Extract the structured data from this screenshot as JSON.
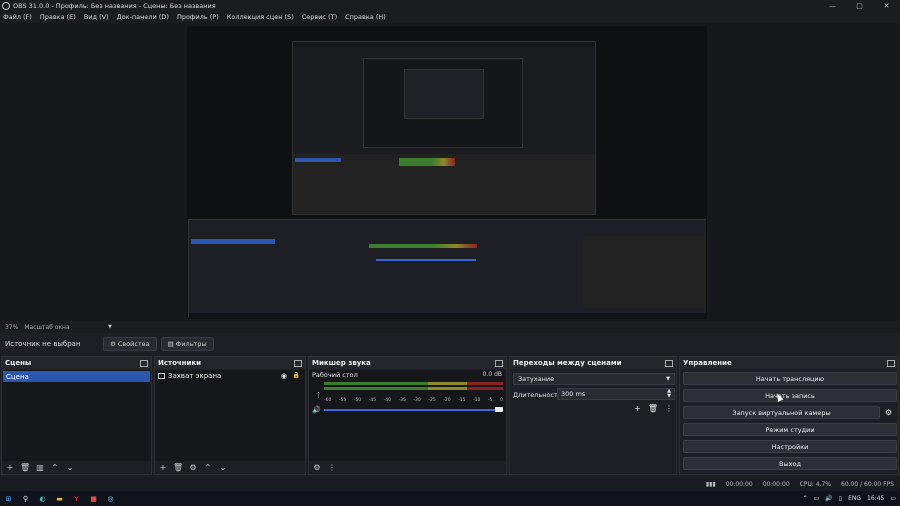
{
  "window": {
    "title": "OBS 31.0.0 - Профиль: Без названия - Сцены: Без названия",
    "minimize": "—",
    "maximize": "▢",
    "close": "✕"
  },
  "menu": [
    "Файл (F)",
    "Правка (E)",
    "Вид (V)",
    "Док-панели (D)",
    "Профиль (P)",
    "Коллекция сцен (S)",
    "Сервис (T)",
    "Справка (H)"
  ],
  "zoom": {
    "percent": "37%",
    "label": "Масштаб окна"
  },
  "source_toolbar": {
    "no_source": "Источник не выбран",
    "properties": "Свойства",
    "filters": "Фильтры"
  },
  "scenes": {
    "title": "Сцены",
    "items": [
      "Сцена"
    ]
  },
  "sources": {
    "title": "Источники",
    "items": [
      "Захват экрана"
    ]
  },
  "mixer": {
    "title": "Микшер звука",
    "channel": "Рабочий стол",
    "db": "0.0 dB",
    "ticks": [
      "-60",
      "-55",
      "-50",
      "-45",
      "-40",
      "-35",
      "-30",
      "-25",
      "-20",
      "-15",
      "-10",
      "-5",
      "0"
    ]
  },
  "transitions": {
    "title": "Переходы между сценами",
    "selected": "Затухание",
    "duration_label": "Длительность",
    "duration": "300 ms"
  },
  "controls": {
    "title": "Управление",
    "buttons": [
      "Начать трансляцию",
      "Начать запись",
      "Запуск виртуальной камеры",
      "Режим студии",
      "Настройки",
      "Выход"
    ]
  },
  "status": {
    "stream_time": "00:00:00",
    "rec_time": "00:00:00",
    "cpu": "CPU: 4.7%",
    "fps": "60.00 / 60.00 FPS"
  },
  "taskbar": {
    "lang": "ENG",
    "time": "16:45"
  }
}
